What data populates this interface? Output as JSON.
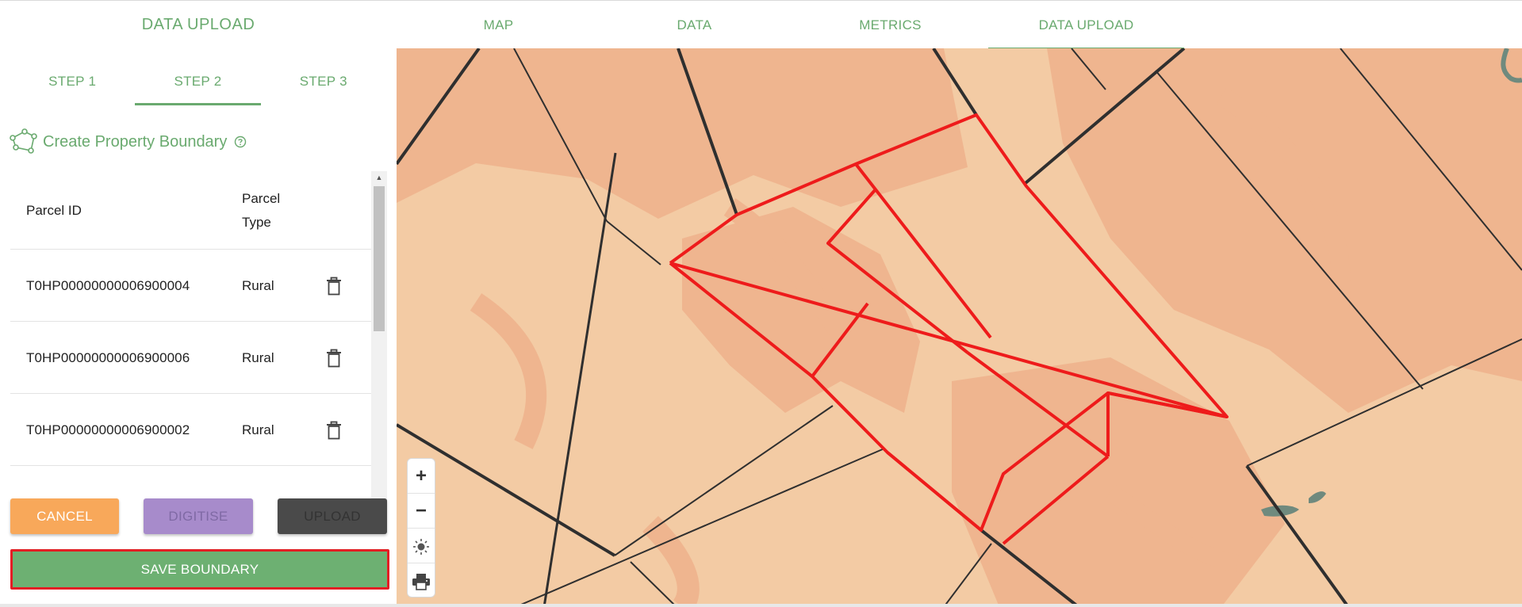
{
  "header": {
    "panel_title": "DATA UPLOAD",
    "nav_tabs": [
      {
        "label": "MAP",
        "active": false
      },
      {
        "label": "DATA",
        "active": false
      },
      {
        "label": "METRICS",
        "active": false
      },
      {
        "label": "DATA UPLOAD",
        "active": true
      }
    ]
  },
  "steps": [
    {
      "label": "STEP 1",
      "active": false
    },
    {
      "label": "STEP 2",
      "active": true
    },
    {
      "label": "STEP 3",
      "active": false
    }
  ],
  "section": {
    "title": "Create Property Boundary",
    "icon": "polygon-icon",
    "help_icon": "help-circle-icon"
  },
  "table": {
    "columns": [
      "Parcel ID",
      "Parcel Type"
    ],
    "rows": [
      {
        "parcel_id": "T0HP00000000006900004",
        "parcel_type": "Rural"
      },
      {
        "parcel_id": "T0HP00000000006900006",
        "parcel_type": "Rural"
      },
      {
        "parcel_id": "T0HP00000000006900002",
        "parcel_type": "Rural"
      }
    ],
    "row_action_icon": "trash-icon"
  },
  "buttons": {
    "cancel": "CANCEL",
    "digitise": "DIGITISE",
    "upload": "UPLOAD",
    "save_boundary": "SAVE BOUNDARY"
  },
  "map_controls": {
    "zoom_in": "+",
    "zoom_out": "−",
    "basemap_icon": "sun-icon",
    "print_icon": "printer-icon"
  },
  "colors": {
    "accent_green": "#6aaa6f",
    "cancel_orange": "#f8a85a",
    "digitise_purple": "#a78bcb",
    "upload_dark": "#4a4a4a",
    "save_green": "#6db072",
    "highlight_red": "#e31e24",
    "map_base": "#f3cba4",
    "map_dark": "#efb58f"
  }
}
